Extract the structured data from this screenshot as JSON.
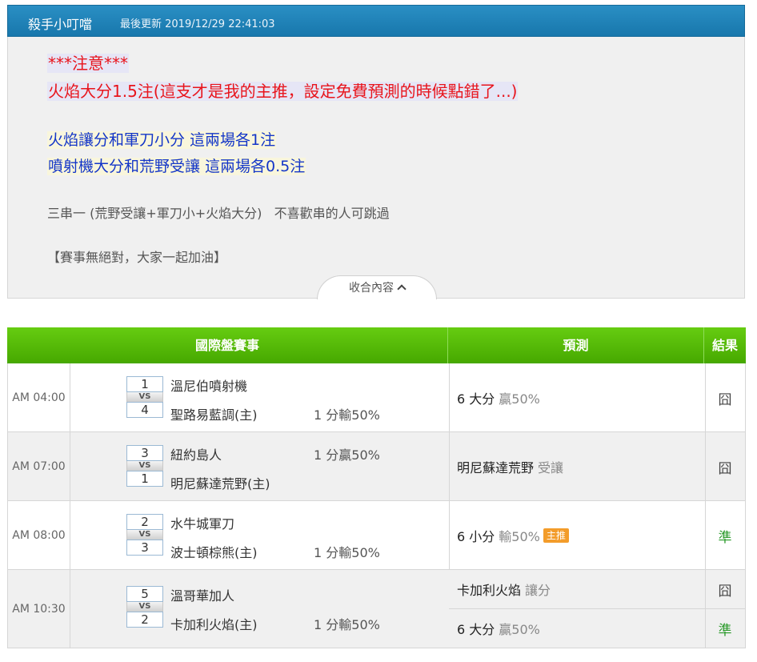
{
  "header": {
    "title": "殺手小叮噹",
    "updated": "最後更新 2019/12/29 22:41:03"
  },
  "notice": {
    "line1": "***注意***",
    "line2": "火焰大分1.5注(這支才是我的主推，設定免費預測的時候點錯了...)",
    "line3": "火焰讓分和軍刀小分 這兩場各1注",
    "line4": "噴射機大分和荒野受讓 這兩場各0.5注",
    "line5": "三串一 (荒野受讓+軍刀小+火焰大分)   不喜歡串的人可跳過",
    "line6": "【賽事無絕對，大家一起加油】",
    "collapse_label": "收合內容"
  },
  "table": {
    "headers": {
      "match": "國際盤賽事",
      "prediction": "預測",
      "result": "結果"
    },
    "vs_label": "VS",
    "rows": [
      {
        "time": "AM 04:00",
        "away": {
          "score": "1",
          "team": "溫尼伯噴射機",
          "handicap": ""
        },
        "home": {
          "score": "4",
          "team": "聖路易藍調(主)",
          "handicap": "1 分輸50%"
        },
        "predictions": [
          {
            "pick": "6 大分",
            "sub": "贏50%",
            "tag": "",
            "result": "囧",
            "result_type": "miss"
          }
        ]
      },
      {
        "time": "AM 07:00",
        "away": {
          "score": "3",
          "team": "紐約島人",
          "handicap": "1 分贏50%"
        },
        "home": {
          "score": "1",
          "team": "明尼蘇達荒野(主)",
          "handicap": ""
        },
        "predictions": [
          {
            "pick": "明尼蘇達荒野",
            "sub": "受讓",
            "tag": "",
            "result": "囧",
            "result_type": "miss"
          }
        ]
      },
      {
        "time": "AM 08:00",
        "away": {
          "score": "2",
          "team": "水牛城軍刀",
          "handicap": ""
        },
        "home": {
          "score": "3",
          "team": "波士頓棕熊(主)",
          "handicap": "1 分輸50%"
        },
        "predictions": [
          {
            "pick": "6 小分",
            "sub": "輸50%",
            "tag": "主推",
            "result": "準",
            "result_type": "hit"
          }
        ]
      },
      {
        "time": "AM 10:30",
        "away": {
          "score": "5",
          "team": "溫哥華加人",
          "handicap": ""
        },
        "home": {
          "score": "2",
          "team": "卡加利火焰(主)",
          "handicap": "1 分輸50%"
        },
        "predictions": [
          {
            "pick": "卡加利火焰",
            "sub": "讓分",
            "tag": "",
            "result": "囧",
            "result_type": "miss"
          },
          {
            "pick": "6 大分",
            "sub": "贏50%",
            "tag": "",
            "result": "準",
            "result_type": "hit"
          }
        ]
      }
    ]
  }
}
